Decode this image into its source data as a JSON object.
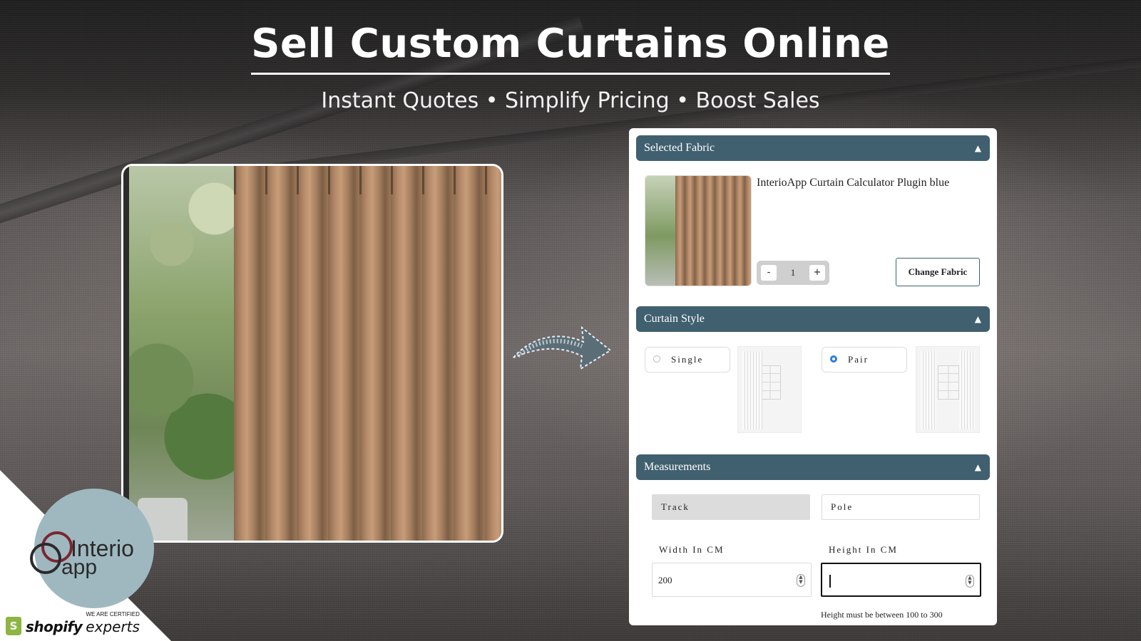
{
  "header": {
    "title": "Sell Custom Curtains Online",
    "subtitle": "Instant Quotes • Simplify Pricing • Boost Sales"
  },
  "panel": {
    "selected_fabric": {
      "heading": "Selected Fabric",
      "fabric_name": "InterioApp Curtain Calculator Plugin blue",
      "minus_label": "-",
      "quantity": "1",
      "plus_label": "+",
      "change_button": "Change Fabric"
    },
    "curtain_style": {
      "heading": "Curtain Style",
      "options": [
        {
          "label": "Single",
          "selected": false
        },
        {
          "label": "Pair",
          "selected": true
        }
      ]
    },
    "measurements": {
      "heading": "Measurements",
      "mount_types": [
        {
          "label": "Track",
          "selected": true
        },
        {
          "label": "Pole",
          "selected": false
        }
      ],
      "width_label": "Width In CM",
      "width_value": "200",
      "height_label": "Height In CM",
      "height_value": "",
      "height_helper": "Height must be between 100 to 300"
    },
    "chevron_icon": "chevron-up-icon"
  },
  "branding": {
    "logo_interio": "Interio",
    "logo_app": "app",
    "certified": "WE ARE CERTIFIED",
    "shopify": "shopify",
    "experts": "experts"
  },
  "colors": {
    "section_header": "#41606f",
    "radio_selected": "#2f7de0",
    "badge_circle": "#9fb8c0"
  }
}
